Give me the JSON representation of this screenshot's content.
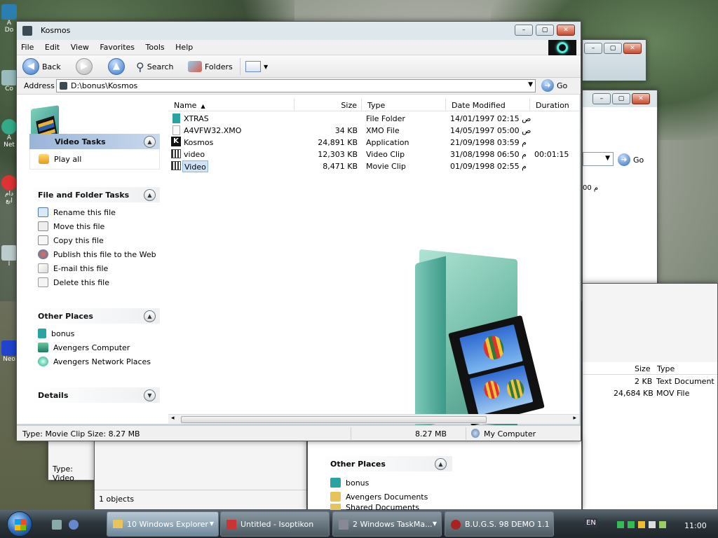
{
  "window": {
    "title": "Kosmos",
    "menu": [
      "File",
      "Edit",
      "View",
      "Favorites",
      "Tools",
      "Help"
    ],
    "toolbar": {
      "back": "Back",
      "search": "Search",
      "folders": "Folders"
    },
    "address": {
      "label": "Address",
      "value": "D:\\bonus\\Kosmos",
      "go": "Go"
    },
    "columns": {
      "name": "Name",
      "size": "Size",
      "type": "Type",
      "modified": "Date Modified",
      "duration": "Duration"
    },
    "files": [
      {
        "name": "XTRAS",
        "size": "",
        "type": "File Folder",
        "modified": "14/01/1997 02:15 ص",
        "duration": "",
        "icon": "folder-icon"
      },
      {
        "name": "A4VFW32.XMO",
        "size": "34 KB",
        "type": "XMO File",
        "modified": "14/05/1997 05:00 ص",
        "duration": "",
        "icon": "file-icon"
      },
      {
        "name": "Kosmos",
        "size": "24,891 KB",
        "type": "Application",
        "modified": "21/09/1998 03:59 م",
        "duration": "",
        "icon": "app-icon"
      },
      {
        "name": "video",
        "size": "12,303 KB",
        "type": "Video Clip",
        "modified": "31/08/1998 06:50 م",
        "duration": "00:01:15",
        "icon": "video-clip-icon"
      },
      {
        "name": "Video",
        "size": "8,471 KB",
        "type": "Movie Clip",
        "modified": "01/09/1998 02:55 م",
        "duration": "",
        "icon": "movie-clip-icon"
      }
    ],
    "tasks": {
      "video": {
        "title": "Video Tasks",
        "items": [
          "Play all"
        ]
      },
      "file": {
        "title": "File and Folder Tasks",
        "items": [
          "Rename this file",
          "Move this file",
          "Copy this file",
          "Publish this file to the Web",
          "E-mail this file",
          "Delete this file"
        ]
      },
      "places": {
        "title": "Other Places",
        "items": [
          "bonus",
          "Avengers Computer",
          "Avengers Network Places"
        ]
      },
      "details": {
        "title": "Details"
      }
    },
    "status": {
      "left": "Type: Movie Clip Size: 8.27 MB",
      "size": "8.27 MB",
      "zone": "My Computer"
    }
  },
  "background_window": {
    "go": "Go",
    "columns": {
      "size": "Size",
      "type": "Type"
    },
    "rows": [
      {
        "size": "2 KB",
        "type": "Text Document"
      },
      {
        "size": "24,684 KB",
        "type": "MOV File"
      }
    ],
    "date_fragment": "م 00",
    "places_title": "Other Places",
    "places": [
      "bonus",
      "Avengers Documents",
      "Shared Documents"
    ],
    "status_left": "Type: Video",
    "status_objects": "1 objects"
  },
  "taskbar": {
    "tasks": [
      "10 Windows Explorer",
      "Untitled - Isoptikon",
      "2 Windows TaskMa...",
      "B.U.G.S. 98 DEMO 1.1"
    ],
    "lang": "EN",
    "clock": "11:00"
  },
  "desktop_labels": [
    "A",
    "Do",
    "Co",
    "A",
    "Net",
    "دام",
    "ابع",
    "I",
    "Neo"
  ],
  "colors": {
    "accent": "#3876c6",
    "selection": "#cfe4f7",
    "taskbar": "#2d363c"
  }
}
